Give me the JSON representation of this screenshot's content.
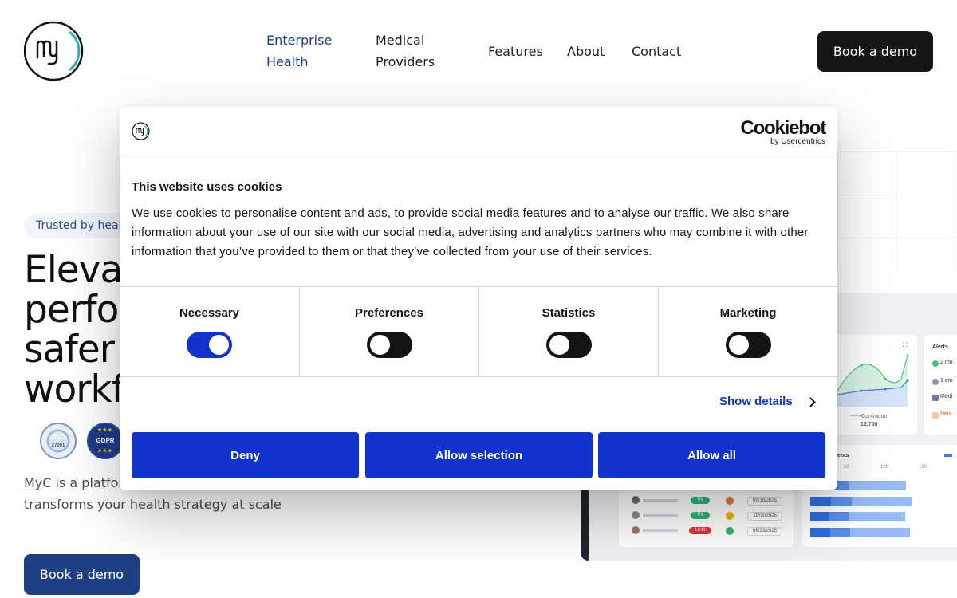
{
  "header": {
    "nav": [
      {
        "line1": "Enterprise",
        "line2": "Health"
      },
      {
        "line1": "Medical",
        "line2": "Providers"
      },
      {
        "label": "Features"
      },
      {
        "label": "About"
      },
      {
        "label": "Contact"
      }
    ],
    "cta": "Book a demo"
  },
  "hero": {
    "trusted": "Trusted by healt",
    "title_lines": [
      "Elevat",
      "perfor",
      "safer a",
      "workfo"
    ],
    "badges": {
      "iso_top": "ISO",
      "iso_num": "27001",
      "gdpr": "GDPR"
    },
    "desc_line1": "MyC is a platform",
    "desc_line2": "transforms your health strategy at scale",
    "cta": "Book a demo"
  },
  "dashboard": {
    "alerts_title": "Alerts",
    "alerts": [
      "2 mo",
      "1 em",
      "Medi",
      "New"
    ],
    "legend": "Contractor",
    "legend_value": "12,750",
    "bar_title": "ents",
    "bar_ticks": [
      "50",
      "100",
      "150"
    ],
    "rows": [
      {
        "status": "Fit",
        "date": "09/18/2025"
      },
      {
        "status": "Fit",
        "date": "11/05/2025"
      },
      {
        "status": "Unfit",
        "date": "06/23/2025"
      }
    ],
    "bars": [
      0.8,
      0.85,
      0.79,
      0.83
    ]
  },
  "cookie": {
    "brand": "Cookiebot",
    "brand_sub": "by Usercentrics",
    "title": "This website uses cookies",
    "body": "We use cookies to personalise content and ads, to provide social media features and to analyse our traffic. We also share information about your use of our site with our social media, advertising and analytics partners who may combine it with other information that you’ve provided to them or that they’ve collected from your use of their services.",
    "categories": [
      {
        "label": "Necessary",
        "on": true
      },
      {
        "label": "Preferences",
        "on": false
      },
      {
        "label": "Statistics",
        "on": false
      },
      {
        "label": "Marketing",
        "on": false
      }
    ],
    "show_details": "Show details",
    "buttons": {
      "deny": "Deny",
      "selection": "Allow selection",
      "all": "Allow all"
    }
  },
  "colors": {
    "accent": "#1032cf",
    "brand_navy": "#1d3f83",
    "teal": "#2bb3b8"
  }
}
